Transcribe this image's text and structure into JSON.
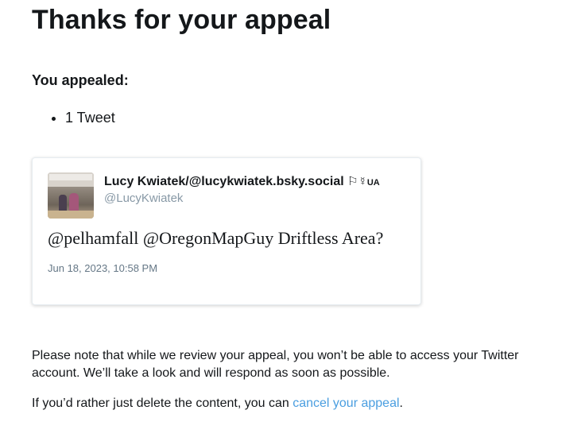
{
  "page": {
    "title": "Thanks for your appeal",
    "appealed_label": "You appealed:",
    "appealed_items": [
      "1 Tweet"
    ]
  },
  "tweet": {
    "display_name": "Lucy Kwiatek/@lucykwiatek.bsky.social",
    "name_flag_icons": "⚐☿",
    "name_suffix": "UA",
    "handle": "@LucyKwiatek",
    "text": "@pelhamfall @OregonMapGuy Driftless Area?",
    "timestamp": "Jun 18, 2023, 10:58 PM",
    "avatar_icon": "profile-photo"
  },
  "notice": {
    "review_note": "Please note that while we review your appeal, you won’t be able to access your Twitter account. We’ll take a look and will respond as soon as possible.",
    "delete_prefix": "If you’d rather just delete the content, you can ",
    "cancel_link_label": "cancel your appeal",
    "delete_suffix": "."
  },
  "colors": {
    "link": "#4a9ee0",
    "text": "#14171a",
    "muted": "#8899a6"
  }
}
